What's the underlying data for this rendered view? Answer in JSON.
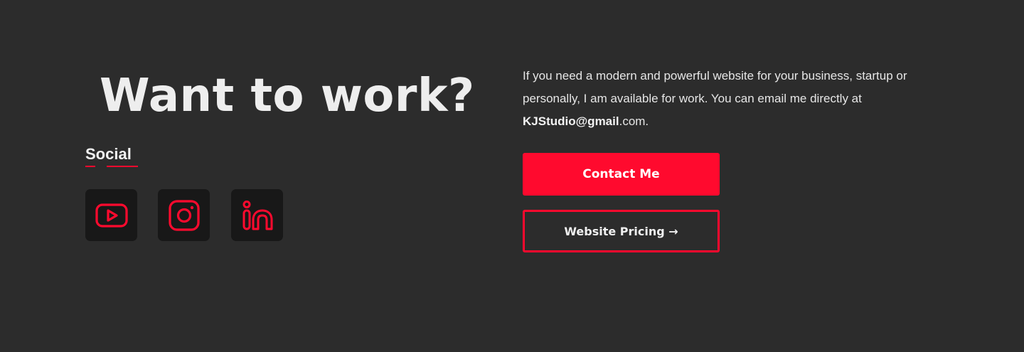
{
  "hero": {
    "heading": "Want to work?"
  },
  "social": {
    "label": "Social",
    "items": [
      {
        "name": "youtube",
        "icon": "youtube-icon"
      },
      {
        "name": "instagram",
        "icon": "instagram-icon"
      },
      {
        "name": "linkedin",
        "icon": "linkedin-icon"
      }
    ]
  },
  "contact": {
    "text_before": "If you need a modern and powerful website for your business, startup or personally, I am available for work. You can email me directly at ",
    "email_bold": "KJStudio@gmail",
    "email_suffix": ".com.",
    "primary_button": "Contact Me",
    "secondary_button": "Website Pricing →"
  },
  "colors": {
    "background": "#2c2c2c",
    "accent": "#ff0a2e",
    "icon_tile": "#181818",
    "text": "#ececec"
  }
}
